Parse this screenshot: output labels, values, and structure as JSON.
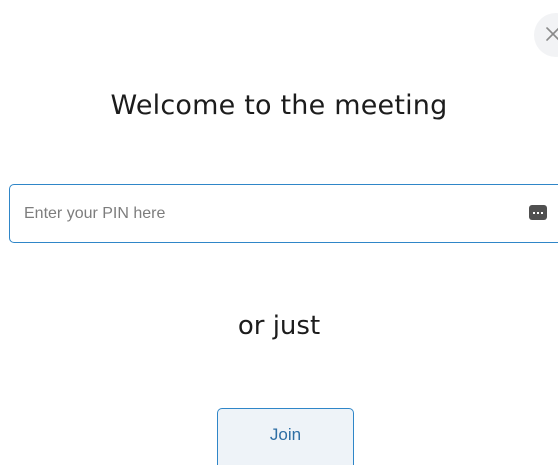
{
  "dialog": {
    "title": "Welcome to the meeting",
    "close_icon": "close-icon"
  },
  "pin": {
    "value": "",
    "placeholder": "Enter your PIN here",
    "icon": "keypad-icon"
  },
  "divider_text": "or just",
  "join": {
    "label": "Join"
  },
  "colors": {
    "accent": "#2f86c8",
    "join_background": "#eef3f8",
    "join_text": "#2d6ea4"
  }
}
